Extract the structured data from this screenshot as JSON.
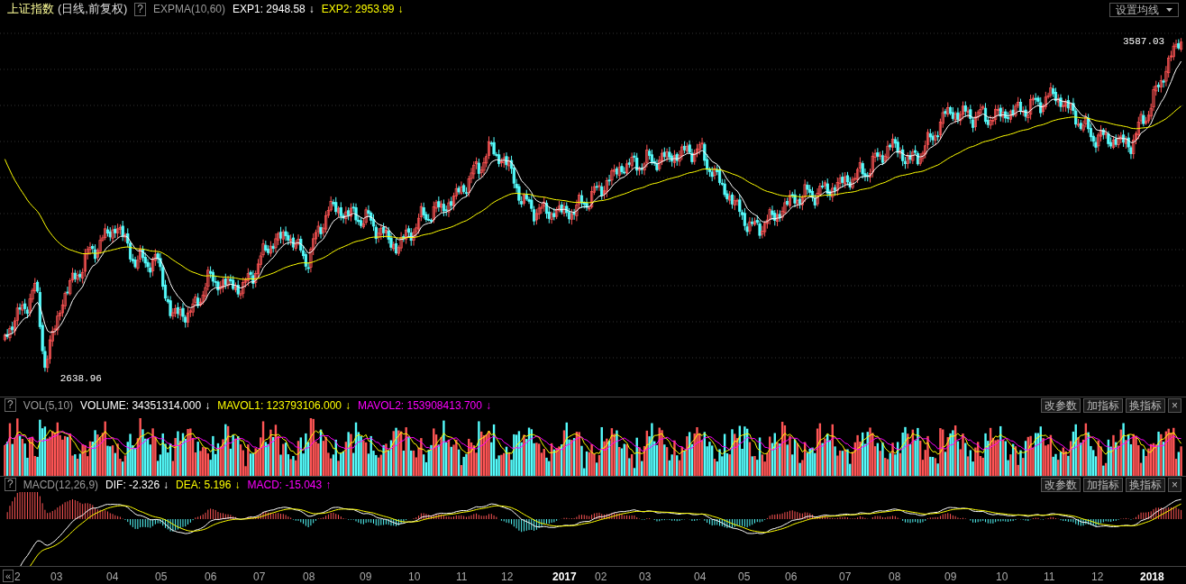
{
  "main": {
    "title": "上证指数",
    "period": "(日线,前复权)",
    "help": "?",
    "indicator": "EXPMA(10,60)",
    "readings": [
      {
        "text": "EXP1: 2948.58",
        "arrow": "↓",
        "color": "#ffffff"
      },
      {
        "text": "EXP2: 2953.99",
        "arrow": "↓",
        "color": "#ffff00"
      }
    ],
    "settings_button": "设置均线",
    "max_label": "3587.03",
    "min_label": "2638.96"
  },
  "volume": {
    "help": "?",
    "indicator": "VOL(5,10)",
    "readings": [
      {
        "text": "VOLUME: 34351314.000",
        "arrow": "↓",
        "color": "#ffffff"
      },
      {
        "text": "MAVOL1: 123793106.000",
        "arrow": "↓",
        "color": "#ffff00"
      },
      {
        "text": "MAVOL2: 153908413.700",
        "arrow": "↓",
        "color": "#ff00ff"
      }
    ],
    "buttons": [
      "改参数",
      "加指标",
      "换指标",
      "×"
    ]
  },
  "macd": {
    "help": "?",
    "indicator": "MACD(12,26,9)",
    "readings": [
      {
        "text": "DIF: -2.326",
        "arrow": "↓",
        "color": "#ffffff"
      },
      {
        "text": "DEA: 5.196",
        "arrow": "↓",
        "color": "#ffff00"
      },
      {
        "text": "MACD: -15.043",
        "arrow": "↑",
        "color": "#ff00ff"
      }
    ],
    "buttons": [
      "改参数",
      "加指标",
      "换指标",
      "×"
    ]
  },
  "time_axis": {
    "collapse_button": "«",
    "labels": [
      {
        "label": "2",
        "highlight": false
      },
      {
        "label": "03",
        "highlight": false
      },
      {
        "label": "04",
        "highlight": false
      },
      {
        "label": "05",
        "highlight": false
      },
      {
        "label": "06",
        "highlight": false
      },
      {
        "label": "07",
        "highlight": false
      },
      {
        "label": "08",
        "highlight": false
      },
      {
        "label": "09",
        "highlight": false
      },
      {
        "label": "10",
        "highlight": false
      },
      {
        "label": "11",
        "highlight": false
      },
      {
        "label": "12",
        "highlight": false
      },
      {
        "label": "2017",
        "highlight": true
      },
      {
        "label": "02",
        "highlight": false
      },
      {
        "label": "03",
        "highlight": false
      },
      {
        "label": "04",
        "highlight": false
      },
      {
        "label": "05",
        "highlight": false
      },
      {
        "label": "06",
        "highlight": false
      },
      {
        "label": "07",
        "highlight": false
      },
      {
        "label": "08",
        "highlight": false
      },
      {
        "label": "09",
        "highlight": false
      },
      {
        "label": "10",
        "highlight": false
      },
      {
        "label": "11",
        "highlight": false
      },
      {
        "label": "12",
        "highlight": false
      },
      {
        "label": "2018",
        "highlight": true
      }
    ]
  }
}
